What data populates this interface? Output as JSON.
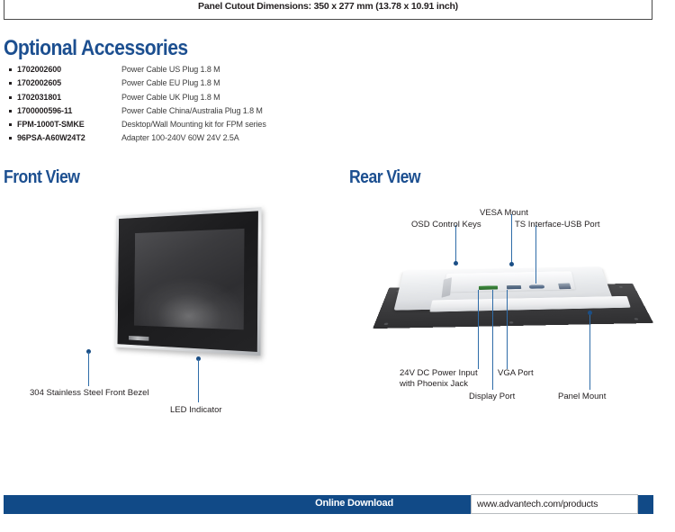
{
  "cutoff_banner": {
    "text": "Panel Cutout Dimensions: 350 x 277 mm (13.78 x 10.91 inch)"
  },
  "optional_accessories": {
    "heading": "Optional Accessories",
    "items": [
      {
        "part_number": "1702002600",
        "description": "Power Cable US Plug 1.8 M"
      },
      {
        "part_number": "1702002605",
        "description": "Power Cable EU Plug 1.8 M"
      },
      {
        "part_number": "1702031801",
        "description": "Power Cable UK Plug 1.8 M"
      },
      {
        "part_number": "1700000596-11",
        "description": "Power Cable China/Australia Plug 1.8 M"
      },
      {
        "part_number": "FPM-1000T-SMKE",
        "description": "Desktop/Wall Mounting kit for FPM series"
      },
      {
        "part_number": "96PSA-A60W24T2",
        "description": "Adapter 100-240V 60W 24V 2.5A"
      }
    ]
  },
  "front_view": {
    "heading": "Front View",
    "labels": {
      "bezel": "304 Stainless Steel Front Bezel",
      "led": "LED Indicator"
    }
  },
  "rear_view": {
    "heading": "Rear View",
    "labels": {
      "osd": "OSD Control Keys",
      "vesa": "VESA Mount",
      "ts_usb": "TS Interface-USB Port",
      "power": "24V DC Power Input\nwith Phoenix Jack",
      "vga": "VGA Port",
      "display_port": "Display Port",
      "panel_mount": "Panel Mount"
    }
  },
  "footer": {
    "download_label": "Online Download",
    "url": "www.advantech.com/products"
  },
  "colors": {
    "heading_blue": "#1c4f90",
    "footer_blue": "#114a87",
    "leader_blue": "#2f6ca8",
    "text_dark": "#231f20"
  }
}
